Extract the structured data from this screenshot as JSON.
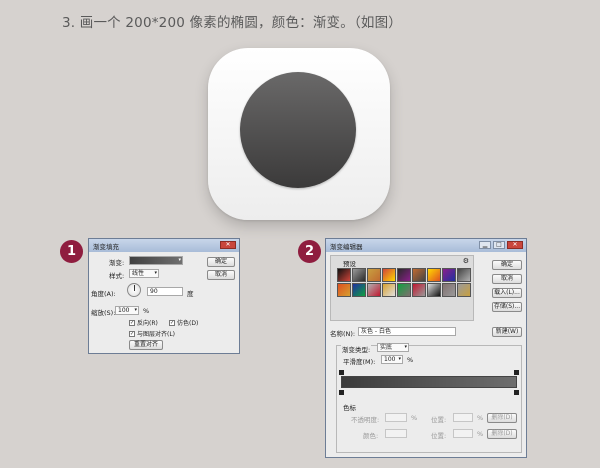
{
  "heading": "3. 画一个 200*200 像素的椭圆，颜色：渐变。（如图）",
  "badges": {
    "one": "1",
    "two": "2"
  },
  "gradient_fill": {
    "title": "渐变填充",
    "gradient_label": "渐变:",
    "style_label": "样式:",
    "style_value": "线性",
    "angle_label": "角度(A):",
    "angle_value": "90",
    "angle_unit": "度",
    "scale_label": "缩放(S):",
    "scale_value": "100",
    "scale_unit": "%",
    "reverse": "反向(R)",
    "dither": "仿色(D)",
    "align_layer": "与图层对齐(L)",
    "reset_align": "重置对齐",
    "ok": "确定",
    "cancel": "取消"
  },
  "gradient_editor": {
    "title": "渐变编辑器",
    "presets_label": "预设",
    "ok": "确定",
    "cancel": "取消",
    "load": "载入(L)...",
    "save": "存储(S)...",
    "name_label": "名称(N):",
    "name_value": "灰色 - 白色",
    "new_button": "新建(W)",
    "type_label": "渐变类型:",
    "type_value": "实底",
    "smooth_label": "平滑度(M):",
    "smooth_value": "100",
    "smooth_unit": "%",
    "stops_label": "色标",
    "opacity_label": "不透明度:",
    "opacity_unit": "%",
    "position_label": "位置:",
    "color_label": "颜色:",
    "delete": "删除(D)",
    "position_unit": "%",
    "bar_colors": [
      "#3b3b3b",
      "#6e6e6e"
    ]
  },
  "preset_swatches": [
    "#111111",
    "#9a9a9a",
    "#c8a040",
    "#d0453a",
    "#2a2a2a",
    "#c06a30",
    "#ffd800",
    "#8a1f8a",
    "#444444",
    "#e05020",
    "#2030a0",
    "#b0b0b0",
    "#d6a030",
    "#10a040",
    "#c01830",
    "#e0e0e0",
    "#807070",
    "#9a9a9a"
  ]
}
